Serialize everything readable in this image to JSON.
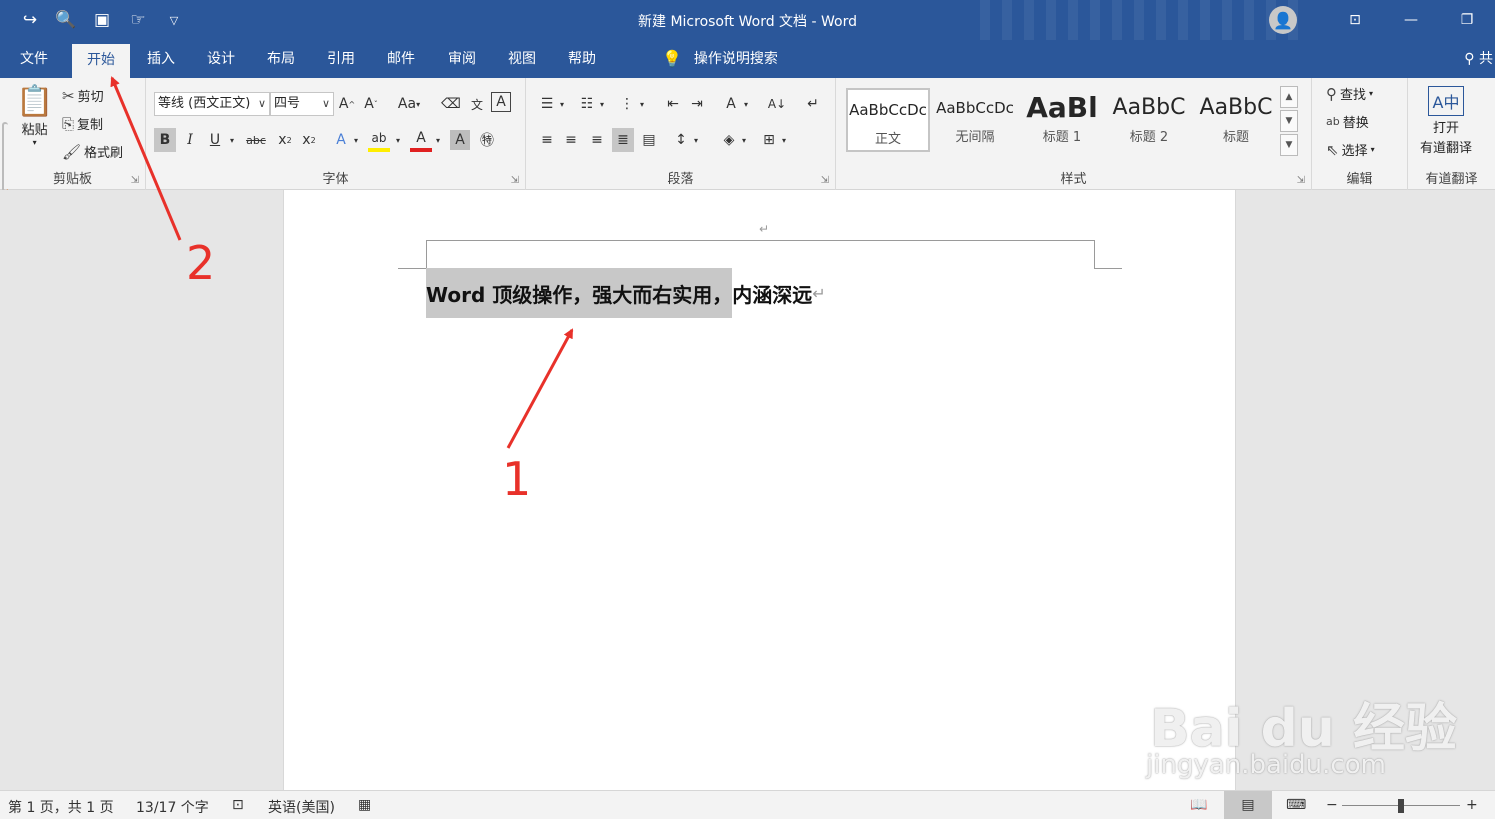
{
  "window": {
    "title": "新建 Microsoft Word 文档 - Word",
    "quick_access": [
      "redo-icon",
      "print-preview-icon",
      "save-icon",
      "touch-mode-icon",
      "customize-qat-icon"
    ],
    "controls": [
      "ribbon-display-options-icon",
      "minimize-icon",
      "restore-icon"
    ],
    "accent": "#2b579a"
  },
  "tabs": [
    {
      "label": "文件",
      "active": false
    },
    {
      "label": "开始",
      "active": true
    },
    {
      "label": "插入",
      "active": false
    },
    {
      "label": "设计",
      "active": false
    },
    {
      "label": "布局",
      "active": false
    },
    {
      "label": "引用",
      "active": false
    },
    {
      "label": "邮件",
      "active": false
    },
    {
      "label": "审阅",
      "active": false
    },
    {
      "label": "视图",
      "active": false
    },
    {
      "label": "帮助",
      "active": false
    }
  ],
  "tell_me": "操作说明搜索",
  "share_label": "共",
  "ribbon": {
    "clipboard": {
      "group_label": "剪贴板",
      "paste": "粘贴",
      "cut": "剪切",
      "copy": "复制",
      "format_painter": "格式刷"
    },
    "font": {
      "group_label": "字体",
      "font_name": "等线 (西文正文)",
      "font_size": "四号",
      "change_case": "Aa"
    },
    "paragraph": {
      "group_label": "段落"
    },
    "styles": {
      "group_label": "样式",
      "items": [
        {
          "sample": "AaBbCcDc",
          "name": "正文",
          "selected": true
        },
        {
          "sample": "AaBbCcDc",
          "name": "无间隔",
          "selected": false
        },
        {
          "sample": "AaBl",
          "name": "标题 1",
          "selected": false
        },
        {
          "sample": "AaBbC",
          "name": "标题 2",
          "selected": false
        },
        {
          "sample": "AaBbC",
          "name": "标题",
          "selected": false
        }
      ]
    },
    "editing": {
      "group_label": "编辑",
      "find": "查找",
      "replace": "替换",
      "select": "选择"
    },
    "youdao": {
      "group_label": "有道翻译",
      "button_line1": "打开",
      "button_line2": "有道翻译"
    }
  },
  "document": {
    "selected_text": "Word 顶级操作，强大而右实用，",
    "rest_text": "内涵深远",
    "paragraph_mark": "↵"
  },
  "status": {
    "page": "第 1 页，共 1 页",
    "words": "13/17 个字",
    "language": "英语(美国)"
  },
  "annotations": {
    "label_1": "1",
    "label_2": "2",
    "color": "#e8312a"
  },
  "watermark": {
    "brand": "Bai  du 经验",
    "url": "jingyan.baidu.com"
  }
}
